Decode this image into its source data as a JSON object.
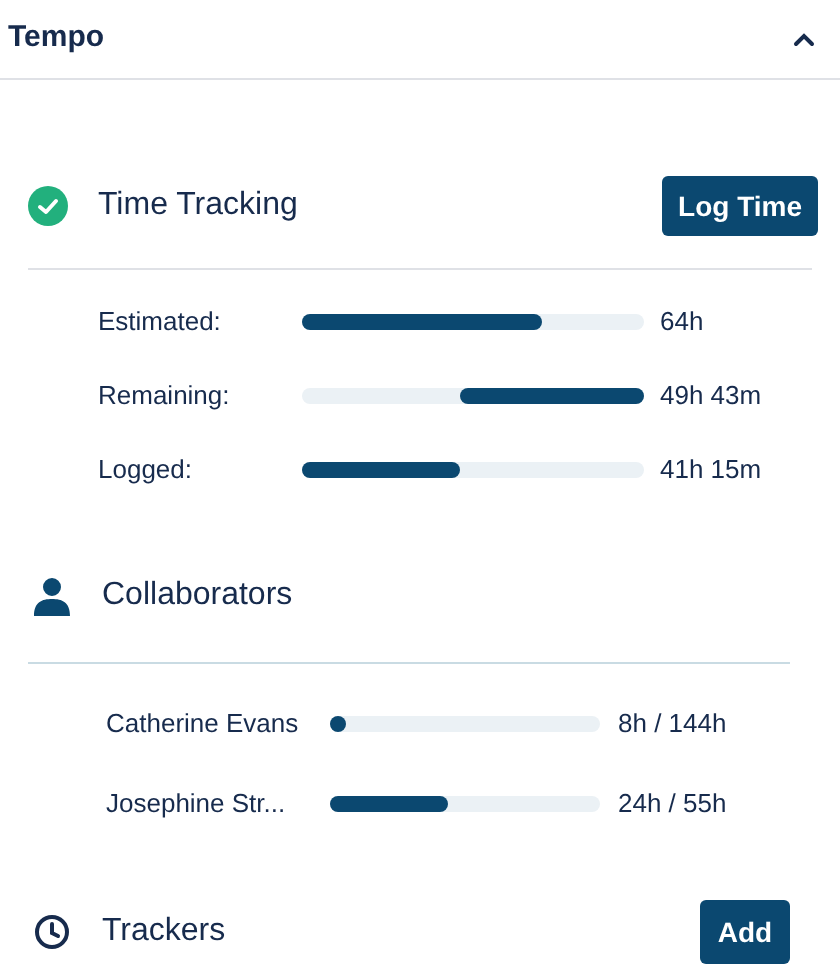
{
  "panel": {
    "title": "Tempo",
    "expanded": true
  },
  "time_tracking": {
    "title": "Time Tracking",
    "complete": true,
    "button": "Log Time",
    "rows": [
      {
        "label": "Estimated:",
        "level": 0.7,
        "kind": "forward",
        "value": "64h"
      },
      {
        "label": "Remaining:",
        "level": 0.54,
        "kind": "reverse",
        "value": "49h 43m"
      },
      {
        "label": "Logged:",
        "level": 0.46,
        "kind": "forward",
        "value": "41h 15m"
      }
    ]
  },
  "collaborators": {
    "title": "Collaborators",
    "rows": [
      {
        "name": "Catherine Evans",
        "level": 0.04,
        "value": "8h / 144h"
      },
      {
        "name": "Josephine Str...",
        "level": 0.44,
        "value": "24h / 55h"
      }
    ]
  },
  "trackers": {
    "title": "Trackers",
    "button": "Add"
  }
}
